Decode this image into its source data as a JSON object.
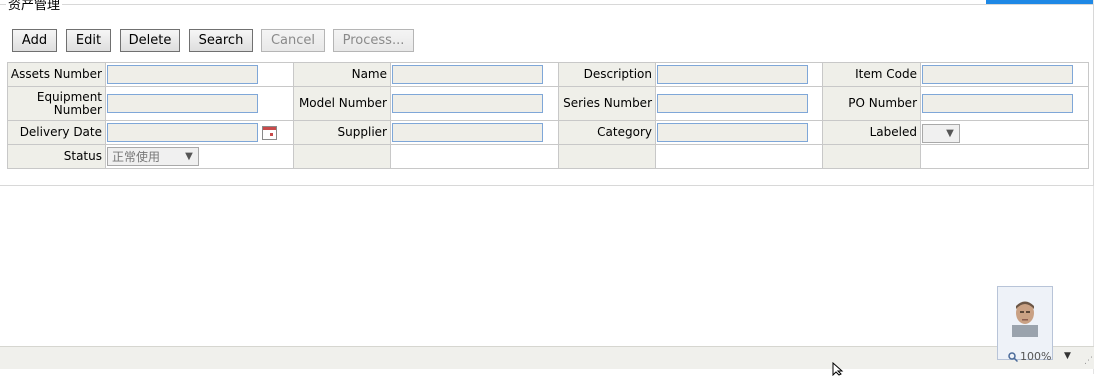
{
  "panel": {
    "title": "资产管理"
  },
  "toolbar": {
    "add_label": "Add",
    "edit_label": "Edit",
    "delete_label": "Delete",
    "search_label": "Search",
    "cancel_label": "Cancel",
    "process_label": "Process..."
  },
  "form": {
    "assets_number_label": "Assets Number",
    "name_label": "Name",
    "description_label": "Description",
    "item_code_label": "Item Code",
    "equipment_number_label": "Equipment Number",
    "model_number_label": "Model Number",
    "series_number_label": "Series Number",
    "po_number_label": "PO Number",
    "delivery_date_label": "Delivery Date",
    "supplier_label": "Supplier",
    "category_label": "Category",
    "labeled_label": "Labeled",
    "labeled_value": "",
    "status_label": "Status",
    "status_value": "正常使用"
  },
  "statusbar": {
    "zoom_text": "100%"
  },
  "colors": {
    "accent": "#1e88e5",
    "input_border": "#7fa7d8",
    "label_bg": "#efefe9"
  },
  "icons": [
    "calendar-icon",
    "chevron-down-icon",
    "magnifier-icon",
    "resize-grip-icon",
    "mouse-cursor-icon"
  ]
}
